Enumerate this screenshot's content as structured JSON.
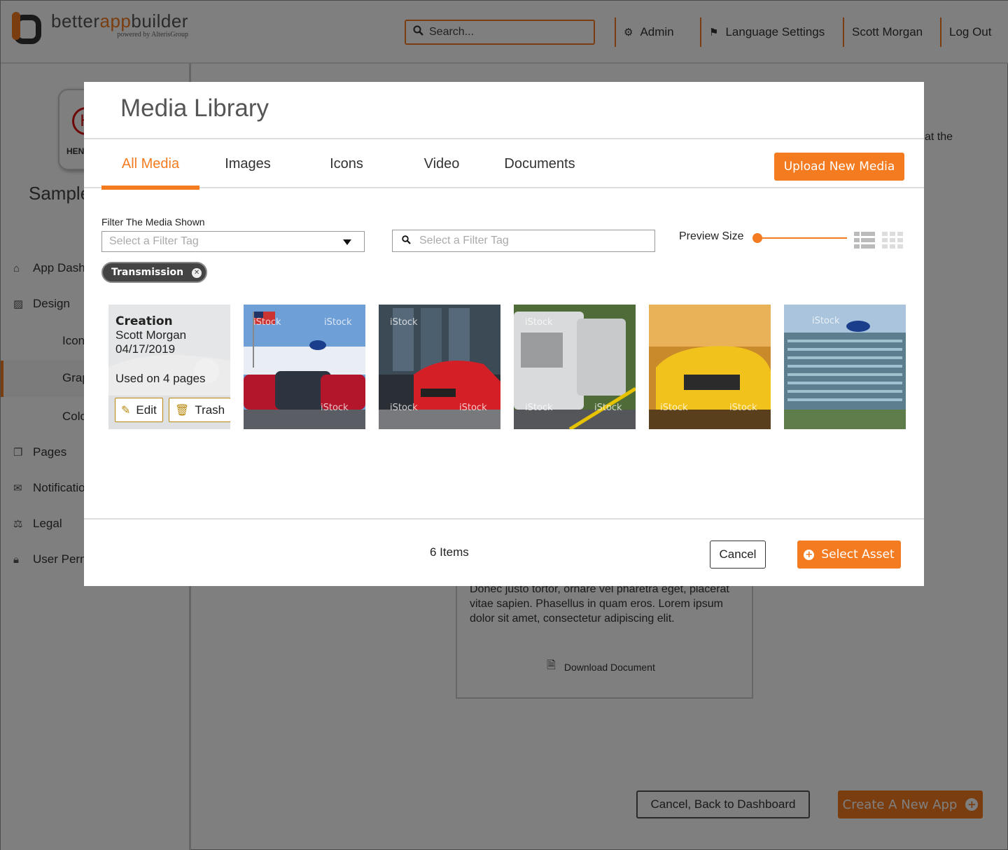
{
  "app": {
    "logo": {
      "prefix": "better",
      "highlight": "app",
      "suffix": "builder",
      "tagline": "powered by AlterisGroup"
    },
    "search": {
      "placeholder": "Search..."
    },
    "topnav": [
      {
        "label": "Admin",
        "icon": "gear-icon"
      },
      {
        "label": "Language Settings",
        "icon": "flag-icon"
      },
      {
        "label": "Scott Morgan"
      },
      {
        "label": "Log Out"
      }
    ],
    "sidebar": {
      "brand_small": "HEN",
      "app_name": "Sample",
      "items": [
        {
          "label": "App Dash",
          "icon": "home-icon"
        },
        {
          "label": "Design",
          "icon": "image-icon"
        },
        {
          "label": "Pages",
          "icon": "pages-icon"
        },
        {
          "label": "Notificatio",
          "icon": "mail-icon"
        },
        {
          "label": "Legal",
          "icon": "scale-icon"
        },
        {
          "label": "User Perm",
          "icon": "lock-icon"
        }
      ],
      "subitems": [
        "Icon",
        "Grap",
        "Colo"
      ]
    },
    "main": {
      "right_snippet": "at the",
      "doc_text": "Donec justo tortor, ornare vel pharetra eget, placerat vitae sapien. Phasellus in quam eros. Lorem ipsum dolor sit amet, consectetur adipiscing elit.",
      "download_label": "Download Document",
      "back_button": "Cancel, Back to Dashboard",
      "create_button": "Create A New App"
    }
  },
  "modal": {
    "title": "Media Library",
    "tabs": [
      "All Media",
      "Images",
      "Icons",
      "Video",
      "Documents"
    ],
    "active_tab": "All Media",
    "upload_button": "Upload New Media",
    "filter_label": "Filter The Media Shown",
    "filter_select_placeholder": "Select a Filter Tag",
    "tag_search_placeholder": "Select a Filter Tag",
    "preview_size_label": "Preview Size",
    "preview_size_value": 0,
    "active_tag": "Transmission",
    "items": [
      {
        "title": "Creation",
        "author": "Scott Morgan",
        "date": "04/17/2019",
        "usage": "Used on 4 pages",
        "edit": "Edit",
        "trash": "Trash"
      },
      {
        "watermark": "iStock"
      },
      {
        "watermark": "iStock"
      },
      {
        "watermark": "iStock"
      },
      {
        "watermark": "iStock"
      },
      {
        "watermark": "iStock"
      }
    ],
    "item_count": "6 Items",
    "cancel_button": "Cancel",
    "select_button": "Select Asset",
    "accent_color": "#f47b20"
  }
}
